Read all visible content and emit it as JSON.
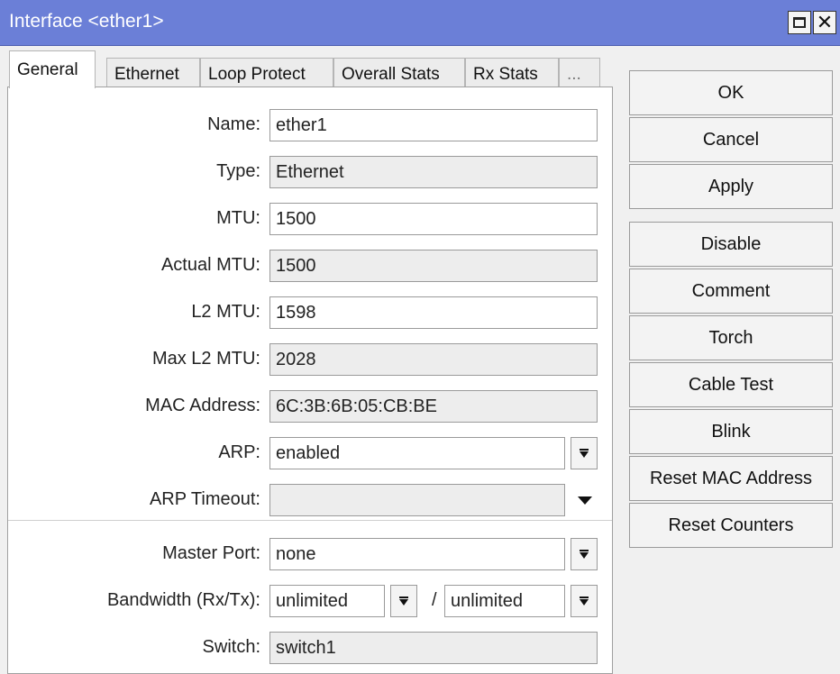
{
  "window": {
    "title": "Interface <ether1>"
  },
  "tabs": [
    {
      "label": "General"
    },
    {
      "label": "Ethernet"
    },
    {
      "label": "Loop Protect"
    },
    {
      "label": "Overall Stats"
    },
    {
      "label": "Rx Stats"
    },
    {
      "label": "..."
    }
  ],
  "form": {
    "name": {
      "label": "Name:",
      "value": "ether1"
    },
    "type": {
      "label": "Type:",
      "value": "Ethernet"
    },
    "mtu": {
      "label": "MTU:",
      "value": "1500"
    },
    "actual_mtu": {
      "label": "Actual MTU:",
      "value": "1500"
    },
    "l2_mtu": {
      "label": "L2 MTU:",
      "value": "1598"
    },
    "max_l2_mtu": {
      "label": "Max L2 MTU:",
      "value": "2028"
    },
    "mac_address": {
      "label": "MAC Address:",
      "value": "6C:3B:6B:05:CB:BE"
    },
    "arp": {
      "label": "ARP:",
      "value": "enabled"
    },
    "arp_timeout": {
      "label": "ARP Timeout:",
      "value": ""
    },
    "master_port": {
      "label": "Master Port:",
      "value": "none"
    },
    "bandwidth": {
      "label": "Bandwidth (Rx/Tx):",
      "rx": "unlimited",
      "separator": "/",
      "tx": "unlimited"
    },
    "switch": {
      "label": "Switch:",
      "value": "switch1"
    }
  },
  "buttons": {
    "ok": "OK",
    "cancel": "Cancel",
    "apply": "Apply",
    "disable": "Disable",
    "comment": "Comment",
    "torch": "Torch",
    "cable_test": "Cable Test",
    "blink": "Blink",
    "reset_mac": "Reset MAC Address",
    "reset_counters": "Reset Counters"
  },
  "colors": {
    "titlebar": "#6b7fd7",
    "panel": "#ffffff",
    "readonly_field": "#ededed"
  }
}
